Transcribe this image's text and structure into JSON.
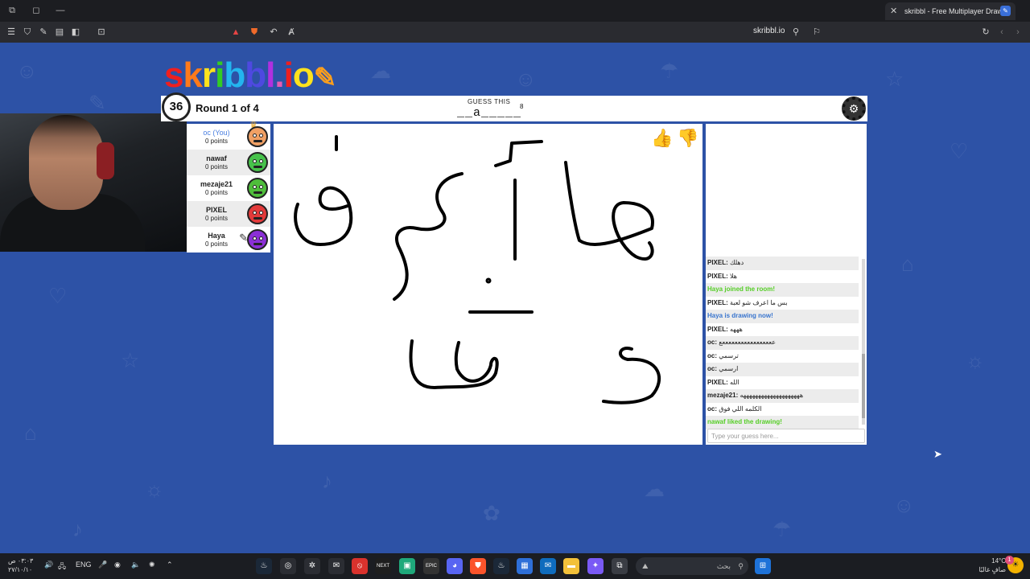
{
  "browser": {
    "tab_title": "skribbl - Free Multiplayer Drawin",
    "url": "skribbl.io"
  },
  "game": {
    "logo": "skribbl.io",
    "timer": "36",
    "round": "Round 1 of 4",
    "guess_label": "GUESS THIS",
    "word_hint": "__a_____",
    "word_length": "8"
  },
  "players": [
    {
      "name": "oc (You)",
      "points": "0 points",
      "avatar_color": "#f0a064",
      "you": true,
      "owner": true
    },
    {
      "name": "nawaf",
      "points": "0 points",
      "avatar_color": "#47c24a"
    },
    {
      "name": "mezaje21",
      "points": "0 points",
      "avatar_color": "#4fbe3b"
    },
    {
      "name": "PIXEL",
      "points": "0 points",
      "avatar_color": "#e23a3a"
    },
    {
      "name": "Haya",
      "points": "0 points",
      "avatar_color": "#8b2fd6",
      "drawing": true
    }
  ],
  "chat": {
    "messages": [
      {
        "type": "msg",
        "user": "PIXEL:",
        "text": "دهلك"
      },
      {
        "type": "msg",
        "user": "PIXEL:",
        "text": "هلا"
      },
      {
        "type": "green",
        "text": "Haya joined the room!"
      },
      {
        "type": "msg",
        "user": "PIXEL:",
        "text": "بس ما اعرف شو لعبة"
      },
      {
        "type": "blue",
        "text": "Haya is drawing now!"
      },
      {
        "type": "msg",
        "user": "PIXEL:",
        "text": "هههه"
      },
      {
        "type": "msg",
        "user": "oc:",
        "text": "عععععععععععععععععع"
      },
      {
        "type": "msg",
        "user": "oc:",
        "text": "ترسمي"
      },
      {
        "type": "msg",
        "user": "oc:",
        "text": "ارسمي"
      },
      {
        "type": "msg",
        "user": "PIXEL:",
        "text": "الله"
      },
      {
        "type": "msg",
        "user": "mezaje21:",
        "text": "ههههههههههههههههههههه"
      },
      {
        "type": "msg",
        "user": "oc:",
        "text": "الكلمه اللي فوق"
      },
      {
        "type": "green",
        "text": "nawaf liked the drawing!"
      }
    ],
    "input_placeholder": "Type your guess here..."
  },
  "taskbar": {
    "time": "٠٣:٠٣ ص",
    "date": "٢٧/١٠/١٠",
    "language": "ENG",
    "search_label": "بحث",
    "weather_temp": "14°C",
    "weather_desc": "صافٍ غالبًا",
    "notification_count": "1"
  },
  "icons": {
    "thumb_up": "thumb-up-icon",
    "thumb_down": "thumb-down-icon",
    "settings": "gear-icon",
    "clock": "alarm-clock-icon"
  },
  "colors": {
    "page_bg": "#2d52a6",
    "you_name": "#4a7fe0",
    "system_green": "#56ce27",
    "system_blue": "#3975ce"
  }
}
